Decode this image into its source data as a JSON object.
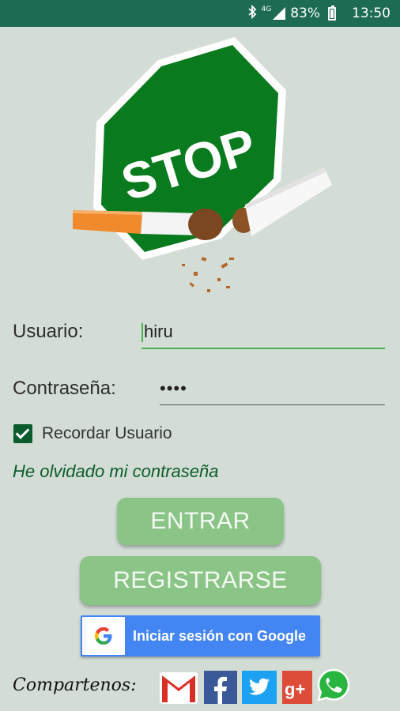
{
  "status_bar": {
    "network": "4G",
    "battery": "83%",
    "time": "13:50",
    "icons": [
      "bluetooth-icon",
      "signal-icon",
      "battery-icon"
    ]
  },
  "logo": {
    "sign_text": "STOP"
  },
  "form": {
    "username_label": "Usuario:",
    "username_value": "hiru",
    "password_label": "Contraseña:",
    "password_value": "••••",
    "remember_label": "Recordar Usuario",
    "remember_checked": true,
    "forgot_link": "He olvidado mi contraseña"
  },
  "buttons": {
    "login": "ENTRAR",
    "register": "REGISTRARSE",
    "google": "Iniciar sesión con Google"
  },
  "share": {
    "label": "Compartenos:",
    "networks": [
      "gmail",
      "facebook",
      "twitter",
      "google-plus",
      "whatsapp"
    ]
  },
  "colors": {
    "status_bar": "#1d6b55",
    "background": "#d3ddd6",
    "accent_green": "#0b5c2c",
    "button_green": "#8bc487",
    "google_blue": "#4485f4"
  }
}
